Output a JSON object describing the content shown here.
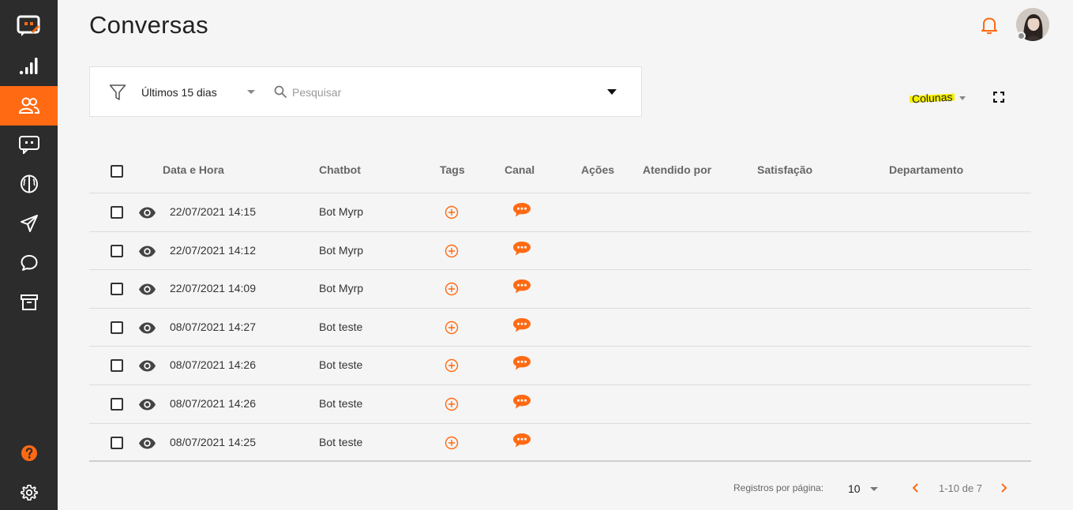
{
  "colors": {
    "accent": "#ff6a13",
    "sidebar": "#2c2c2c",
    "help": "#ff6a13",
    "highlight": "#f6f000"
  },
  "page": {
    "title": "Conversas"
  },
  "sidebar": {
    "items": [
      {
        "name": "logo-icon",
        "active": false
      },
      {
        "name": "analytics-icon",
        "active": false
      },
      {
        "name": "users-icon",
        "active": true
      },
      {
        "name": "chatbot-icon",
        "active": false
      },
      {
        "name": "brain-icon",
        "active": false
      },
      {
        "name": "send-icon",
        "active": false
      },
      {
        "name": "chat-bubble-icon",
        "active": false
      },
      {
        "name": "archive-icon",
        "active": false
      },
      {
        "name": "help-icon",
        "active": false
      },
      {
        "name": "gear-icon",
        "active": false
      }
    ]
  },
  "filters": {
    "period": "Últimos 15 dias",
    "search_placeholder": "Pesquisar"
  },
  "toolbar": {
    "columns_label": "Colunas"
  },
  "table": {
    "headers": {
      "date": "Data e Hora",
      "chatbot": "Chatbot",
      "tags": "Tags",
      "canal": "Canal",
      "acoes": "Ações",
      "atendido": "Atendido por",
      "satisfacao": "Satisfação",
      "departamento": "Departamento"
    },
    "rows": [
      {
        "date": "22/07/2021 14:15",
        "chatbot": "Bot Myrp"
      },
      {
        "date": "22/07/2021 14:12",
        "chatbot": "Bot Myrp"
      },
      {
        "date": "22/07/2021 14:09",
        "chatbot": "Bot Myrp"
      },
      {
        "date": "08/07/2021 14:27",
        "chatbot": "Bot teste"
      },
      {
        "date": "08/07/2021 14:26",
        "chatbot": "Bot teste"
      },
      {
        "date": "08/07/2021 14:26",
        "chatbot": "Bot teste"
      },
      {
        "date": "08/07/2021 14:25",
        "chatbot": "Bot teste"
      }
    ]
  },
  "pagination": {
    "rows_per_page_label": "Registros por página:",
    "rows_per_page": "10",
    "range": "1-10 de 7"
  }
}
